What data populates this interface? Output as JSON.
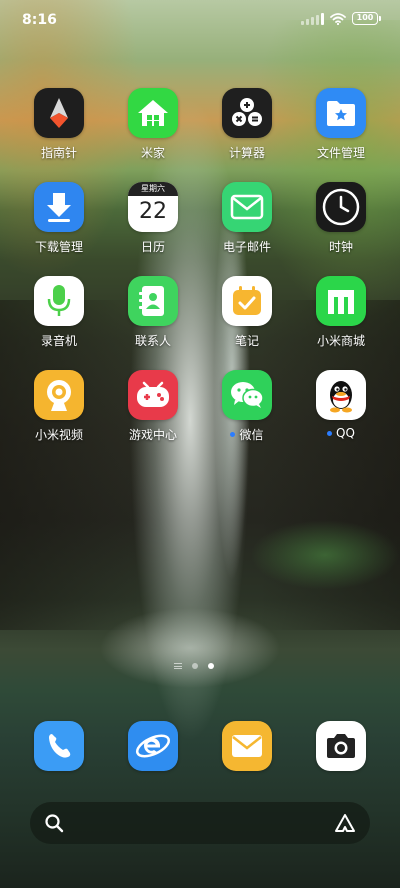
{
  "status_bar": {
    "time": "8:16",
    "battery": "100"
  },
  "apps": [
    {
      "label": "指南针",
      "icon": "compass-icon",
      "badge_dot": false
    },
    {
      "label": "米家",
      "icon": "mijia-home-icon",
      "badge_dot": false
    },
    {
      "label": "计算器",
      "icon": "calculator-icon",
      "badge_dot": false
    },
    {
      "label": "文件管理",
      "icon": "file-manager-icon",
      "badge_dot": false
    },
    {
      "label": "下载管理",
      "icon": "download-icon",
      "badge_dot": false
    },
    {
      "label": "日历",
      "icon": "calendar-icon",
      "badge_dot": false
    },
    {
      "label": "电子邮件",
      "icon": "email-icon",
      "badge_dot": false
    },
    {
      "label": "时钟",
      "icon": "clock-icon",
      "badge_dot": false
    },
    {
      "label": "录音机",
      "icon": "recorder-icon",
      "badge_dot": false
    },
    {
      "label": "联系人",
      "icon": "contacts-icon",
      "badge_dot": false
    },
    {
      "label": "笔记",
      "icon": "notes-icon",
      "badge_dot": false
    },
    {
      "label": "小米商城",
      "icon": "mi-store-icon",
      "badge_dot": false
    },
    {
      "label": "小米视频",
      "icon": "mi-video-icon",
      "badge_dot": false
    },
    {
      "label": "游戏中心",
      "icon": "game-center-icon",
      "badge_dot": false
    },
    {
      "label": "微信",
      "icon": "wechat-icon",
      "badge_dot": true
    },
    {
      "label": "QQ",
      "icon": "qq-icon",
      "badge_dot": true
    }
  ],
  "calendar": {
    "weekday": "星期六",
    "day": "22"
  },
  "pager": {
    "pages": 2,
    "active_page": 2
  },
  "dock": [
    {
      "icon": "phone-icon"
    },
    {
      "icon": "browser-icon"
    },
    {
      "icon": "messages-icon"
    },
    {
      "icon": "camera-icon"
    }
  ],
  "colors": {
    "mijia_green": "#32d843",
    "file_blue": "#2f8bf5",
    "download_blue": "#2f86f0",
    "notes_yellow": "#f7b630",
    "game_red": "#e83a4a",
    "wechat_green": "#2fd15a",
    "phone_blue": "#3b9cf5",
    "message_yellow": "#f5b731",
    "badge_blue": "#2b7dff"
  }
}
